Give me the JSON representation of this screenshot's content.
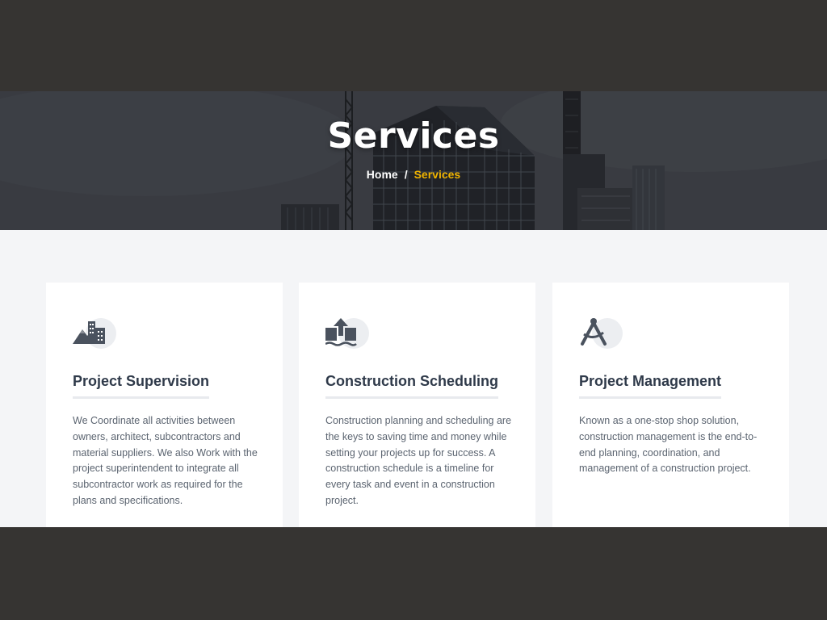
{
  "hero": {
    "title": "Services",
    "breadcrumb": {
      "home": "Home",
      "separator": "/",
      "current": "Services"
    }
  },
  "services": [
    {
      "icon": "mountain-buildings-icon",
      "title": "Project Supervision",
      "description": "We Coordinate all activities between owners, architect, subcontractors and material suppliers. We also Work with the project superintendent to integrate all subcontractor work as required for the plans and specifications."
    },
    {
      "icon": "upload-box-icon",
      "title": "Construction Scheduling",
      "description": "Construction planning and scheduling are the keys to saving time and money while setting your projects up for success. A construction schedule is a timeline for every task and event in a construction project."
    },
    {
      "icon": "compass-drafting-icon",
      "title": "Project Management",
      "description": "Known as a one-stop shop solution, construction management is the end-to-end planning, coordination, and management of a construction project."
    }
  ],
  "colors": {
    "accent": "#f0b400",
    "heading": "#2f3a4a",
    "icon": "#4a525e"
  }
}
